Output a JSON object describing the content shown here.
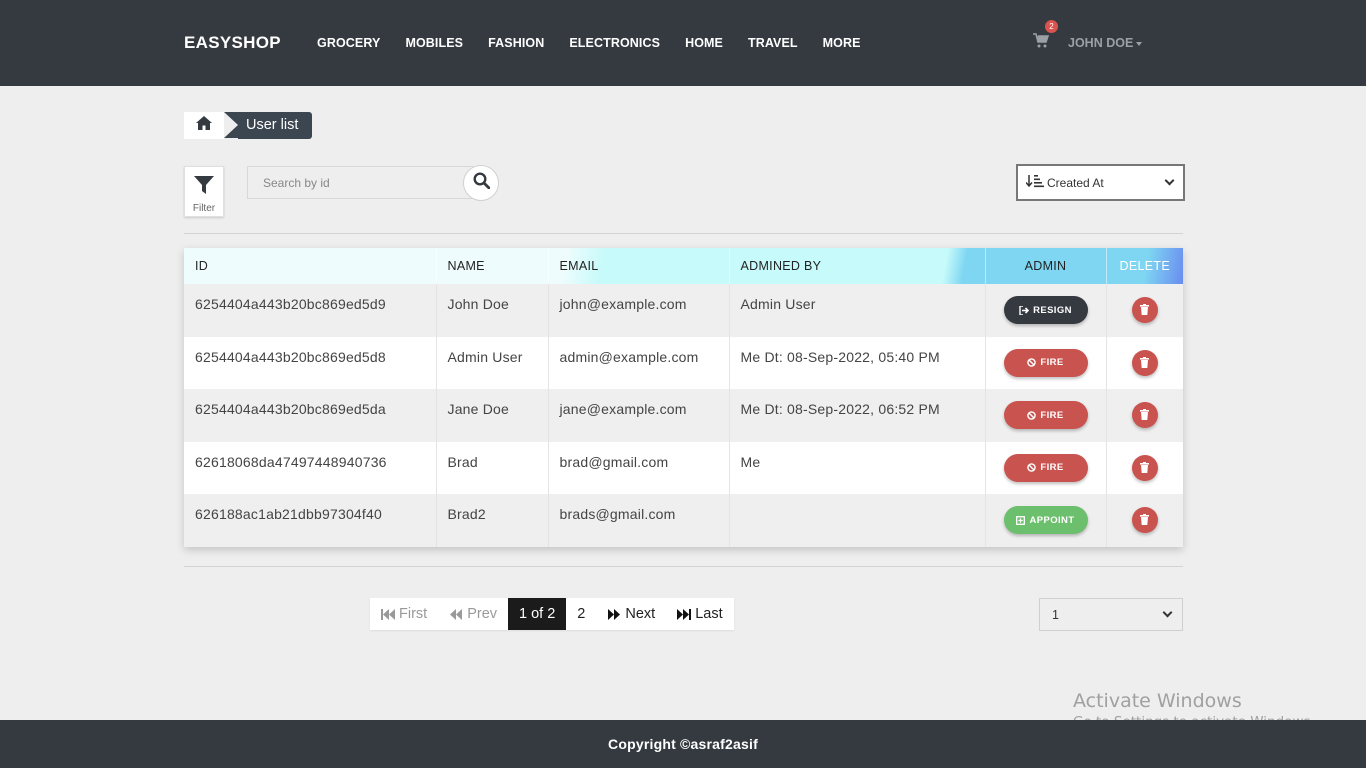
{
  "navbar": {
    "brand": "EASYSHOP",
    "links": [
      "GROCERY",
      "MOBILES",
      "FASHION",
      "ELECTRONICS",
      "HOME",
      "TRAVEL",
      "MORE"
    ],
    "cart_count": "2",
    "user": "JOHN DOE",
    "icons": {
      "cart": "shopping-cart-icon"
    }
  },
  "breadcrumb": {
    "home_icon": "home-icon",
    "current": "User list"
  },
  "toolbar": {
    "filter_label": "Filter",
    "search_placeholder": "Search by id",
    "sort_value": "Created At"
  },
  "table": {
    "headers": {
      "id": "ID",
      "name": "NAME",
      "email": "EMAIL",
      "admined_by": "ADMINED BY",
      "admin": "ADMIN",
      "delete": "DELETE"
    },
    "rows": [
      {
        "id": "6254404a443b20bc869ed5d9",
        "name": "John Doe",
        "email": "john@example.com",
        "admined_by": "Admin User",
        "action": "RESIGN",
        "action_style": "dark"
      },
      {
        "id": "6254404a443b20bc869ed5d8",
        "name": "Admin User",
        "email": "admin@example.com",
        "admined_by": "Me Dt: 08-Sep-2022, 05:40 PM",
        "action": "FIRE",
        "action_style": "red"
      },
      {
        "id": "6254404a443b20bc869ed5da",
        "name": "Jane Doe",
        "email": "jane@example.com",
        "admined_by": "Me Dt: 08-Sep-2022, 06:52 PM",
        "action": "FIRE",
        "action_style": "red"
      },
      {
        "id": "62618068da47497448940736",
        "name": "Brad",
        "email": "brad@gmail.com",
        "admined_by": "Me",
        "action": "FIRE",
        "action_style": "red"
      },
      {
        "id": "626188ac1ab21dbb97304f40",
        "name": "Brad2",
        "email": "brads@gmail.com",
        "admined_by": "",
        "action": "APPOINT",
        "action_style": "green"
      }
    ]
  },
  "pagination": {
    "first": "First",
    "prev": "Prev",
    "current": "1 of 2",
    "page2": "2",
    "next": "Next",
    "last": "Last",
    "page_select_value": "1"
  },
  "watermark": {
    "title": "Activate Windows",
    "subtitle": "Go to Settings to activate Windows."
  },
  "footer": {
    "copyright": "Copyright ©asraf2asif"
  },
  "colors": {
    "navbar": "#343a40",
    "danger": "#c9534f",
    "success": "#6cbf6c",
    "dark": "#343a40"
  }
}
